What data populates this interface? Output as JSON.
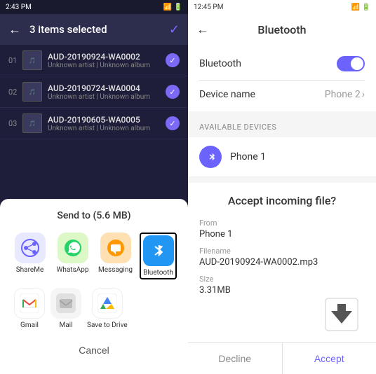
{
  "left": {
    "status_bar": {
      "time": "2:43 PM",
      "icons": "signal"
    },
    "header": {
      "title": "3 items selected",
      "back_label": "←",
      "check_label": "✓"
    },
    "files": [
      {
        "number": "01",
        "name": "AUD-20190924-WA0002",
        "meta": "Unknown artist | Unknown album",
        "checked": true
      },
      {
        "number": "02",
        "name": "AUD-20190724-WA0004",
        "meta": "Unknown artist | Unknown album",
        "checked": true
      },
      {
        "number": "03",
        "name": "AUD-20190605-WA0005",
        "meta": "Unknown artist | Unknown album",
        "checked": true
      }
    ],
    "share_modal": {
      "title": "Send to (5.6 MB)",
      "apps": [
        {
          "id": "shareme",
          "label": "ShareMe",
          "icon": "∞",
          "bg": "#e8e8ff",
          "color": "#6c63ff",
          "highlighted": false
        },
        {
          "id": "whatsapp",
          "label": "WhatsApp",
          "icon": "💬",
          "bg": "#dcf8c6",
          "color": "#25d366",
          "highlighted": false
        },
        {
          "id": "messaging",
          "label": "Messaging",
          "icon": "✉",
          "bg": "#ffe0b2",
          "color": "#ff9800",
          "highlighted": false
        },
        {
          "id": "bluetooth",
          "label": "Bluetooth",
          "icon": "⦿",
          "bg": "#e3f2fd",
          "color": "#2196f3",
          "highlighted": true
        }
      ],
      "apps_row2": [
        {
          "id": "gmail",
          "label": "Gmail",
          "icon": "M",
          "bg": "#fff",
          "color": "#ea4335",
          "highlighted": false
        },
        {
          "id": "mail",
          "label": "Mail",
          "icon": "✉",
          "bg": "#f5f5f5",
          "color": "#607d8b",
          "highlighted": false
        },
        {
          "id": "drive",
          "label": "Save to Drive",
          "icon": "▲",
          "bg": "#fff",
          "color": "#34a853",
          "highlighted": false
        }
      ],
      "cancel_label": "Cancel"
    }
  },
  "right": {
    "status_bar": {
      "time": "12:45 PM",
      "icons": "signal"
    },
    "header": {
      "title": "Bluetooth",
      "back_label": "←"
    },
    "settings": {
      "bluetooth_label": "Bluetooth",
      "toggle_on": true,
      "device_name_label": "Device name",
      "device_name_value": "Phone 2"
    },
    "available_section": {
      "label": "AVAILABLE DEVICES"
    },
    "devices": [
      {
        "name": "Phone 1",
        "avatar": "B"
      }
    ],
    "accept_dialog": {
      "title": "Accept incoming file?",
      "from_label": "From",
      "from_value": "Phone 1",
      "filename_label": "Filename",
      "filename_value": "AUD-20190924-WA0002.mp3",
      "size_label": "Size",
      "size_value": "3.31MB",
      "decline_label": "Decline",
      "accept_label": "Accept"
    }
  }
}
